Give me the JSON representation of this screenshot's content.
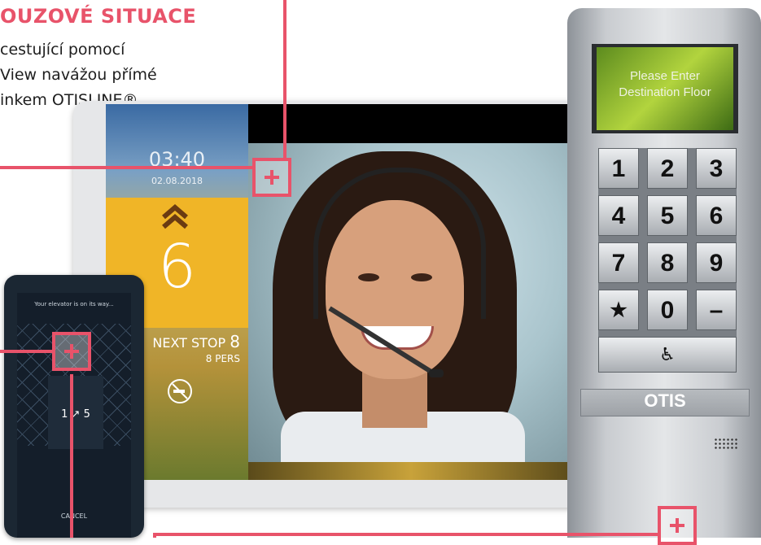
{
  "header": {
    "title": "OUZOVÉ SITUACE",
    "lines": [
      "cestující pomocí",
      "View navážou přímé",
      "inkem OTISLINE®."
    ]
  },
  "tablet": {
    "time": "03:40",
    "date": "02.08.2018",
    "floor": "6",
    "next_stop_label": "NEXT STOP",
    "next_stop_value": "8",
    "persons": "8 PERS"
  },
  "phone": {
    "message": "Your elevator is on its way...",
    "route": "1 ↗ 5",
    "cancel_label": "CANCEL"
  },
  "keypad": {
    "display_line1": "Please Enter",
    "display_line2": "Destination Floor",
    "keys": [
      "1",
      "2",
      "3",
      "4",
      "5",
      "6",
      "7",
      "8",
      "9",
      "★",
      "0",
      "–"
    ],
    "accessibility_key": "♿",
    "brand": "OTIS"
  },
  "colors": {
    "accent": "#e8536a",
    "floor_tile": "#f0b527"
  },
  "icons": {
    "up_arrow": "double-chevron-up-icon",
    "no_smoking": "no-smoking-icon",
    "accessibility": "wheelchair-icon",
    "hotspot": "plus-icon"
  }
}
